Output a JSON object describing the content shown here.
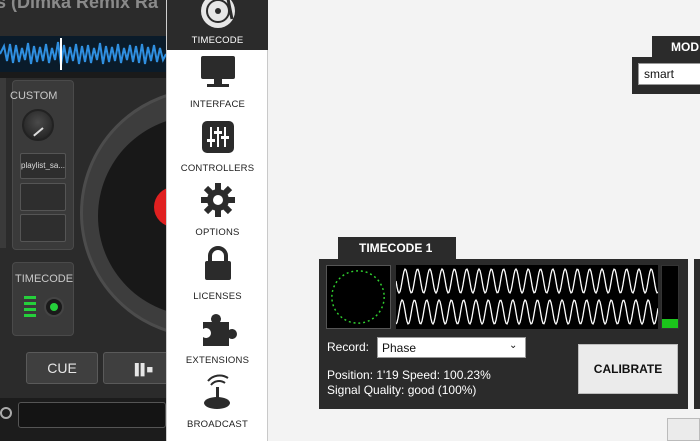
{
  "deck": {
    "title": "s (Dimka Remix Ra",
    "custom_label": "CUSTOM",
    "playlist_pad": "playlist_sa...",
    "timecode_label": "TIMECODE",
    "cue_label": "CUE"
  },
  "sidebar": {
    "items": [
      {
        "label": "TIMECODE",
        "icon": "vinyl-timecode-icon",
        "active": true
      },
      {
        "label": "INTERFACE",
        "icon": "monitor-icon"
      },
      {
        "label": "CONTROLLERS",
        "icon": "sliders-icon"
      },
      {
        "label": "OPTIONS",
        "icon": "gear-icon"
      },
      {
        "label": "LICENSES",
        "icon": "lock-icon"
      },
      {
        "label": "EXTENSIONS",
        "icon": "puzzle-icon"
      },
      {
        "label": "BROADCAST",
        "icon": "satellite-dish-icon"
      }
    ]
  },
  "mode": {
    "tab_label": "MOD",
    "selected": "smart"
  },
  "timecode1": {
    "tab_label": "TIMECODE 1",
    "record_label": "Record:",
    "record_selected": "Phase",
    "position_text": "Position: 1'19  Speed: 100.23%",
    "signal_quality_text": "Signal Quality: good (100%)",
    "calibrate_label": "CALIBRATE",
    "signal_level": 0.15
  },
  "colors": {
    "panel": "#2b2b2b",
    "accent_green": "#1bc41b",
    "background": "#f3f3f3"
  }
}
